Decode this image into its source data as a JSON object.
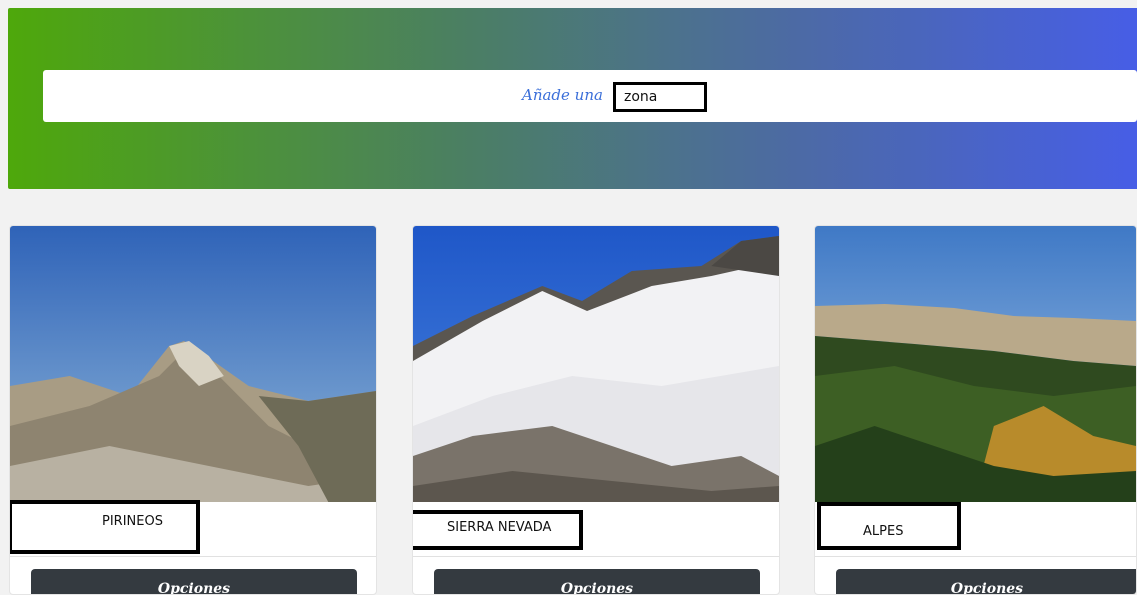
{
  "header": {
    "prompt_label": "Añade una",
    "zone_input_value": "zona"
  },
  "zones": [
    {
      "name": "PIRINEOS",
      "photo": "mountain-photo",
      "options_label": "Opciones"
    },
    {
      "name": "SIERRA NEVADA",
      "photo": "snowy-mountain-photo",
      "options_label": "Opciones"
    },
    {
      "name": "ALPES",
      "photo": "forest-cliff-photo",
      "options_label": "Opciones"
    }
  ],
  "colors": {
    "hero_start": "#4ea80b",
    "hero_end": "#475ee6",
    "prompt_text": "#3b6fd9",
    "options_button": "#343a40"
  }
}
